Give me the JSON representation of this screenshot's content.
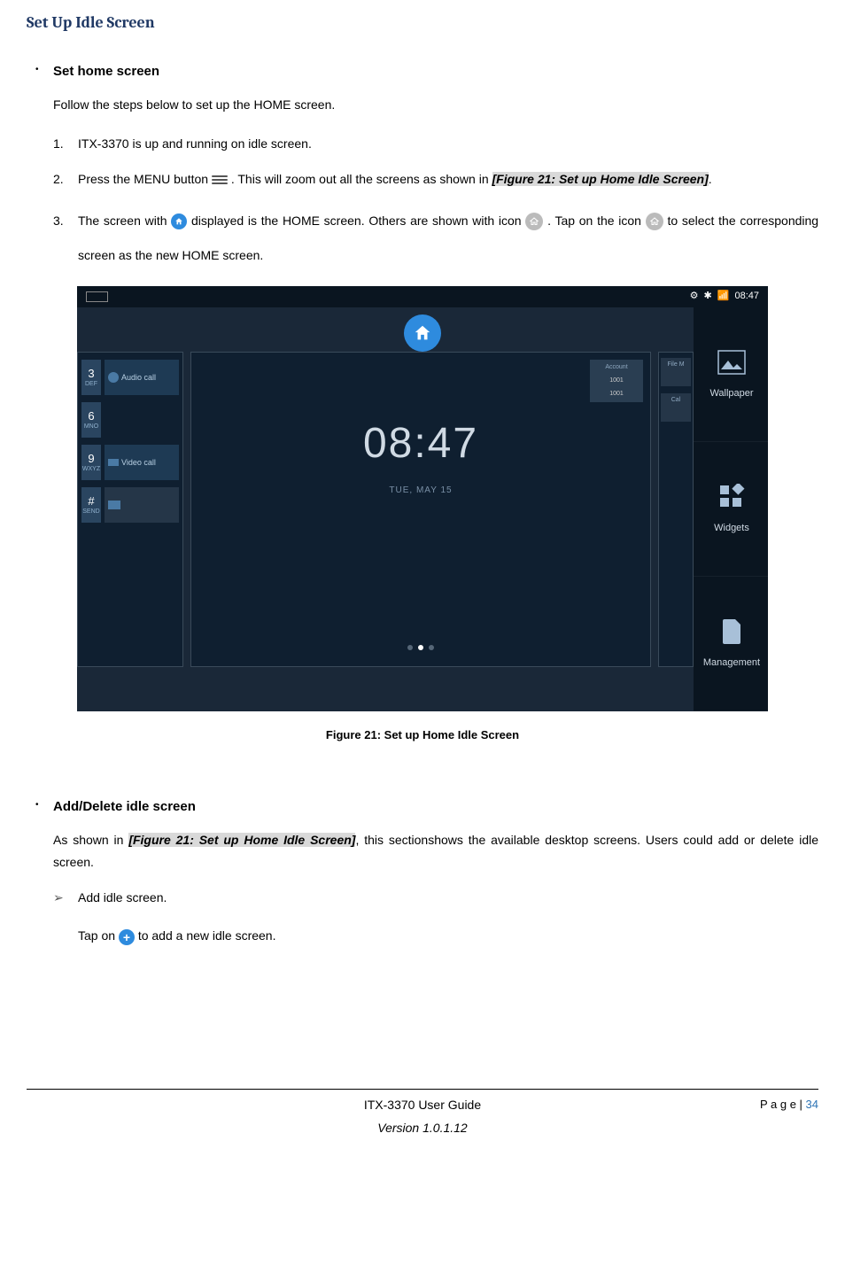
{
  "section_title": "Set Up Idle Screen",
  "set_home": {
    "heading": "Set home screen",
    "intro": "Follow the steps below to set up the HOME screen.",
    "step1": "ITX-3370 is up and running on idle screen.",
    "step2a": "Press the MENU button ",
    "step2b": ". This will zoom out all the screens as shown in ",
    "step2ref": "[Figure 21: Set up Home Idle Screen]",
    "step2c": ".",
    "step3a": "The screen with",
    "step3b": "displayed is the HOME screen. Others are shown with icon",
    "step3c": " . Tap on the icon ",
    "step3d": " to select the corresponding screen as the new HOME screen."
  },
  "screenshot": {
    "time": "08:47",
    "clock_time": "08:47",
    "clock_date": "TUE, MAY 15",
    "account_hdr": "Account",
    "account_num1": "1001",
    "account_num2": "1001",
    "filem": "File M",
    "cal": "Cal",
    "keys": {
      "k3": "3",
      "k3s": "DEF",
      "k6": "6",
      "k6s": "MNO",
      "k9": "9",
      "k9s": "WXYZ",
      "kh": "#",
      "khs": "SEND"
    },
    "audio_call": "Audio call",
    "video_call": "Video call",
    "side": {
      "wallpaper": "Wallpaper",
      "widgets": "Widgets",
      "management": "Management"
    }
  },
  "figure_caption": "Figure 21: Set up Home Idle Screen",
  "add_delete": {
    "heading": "Add/Delete idle screen",
    "body_a": "As shown in ",
    "body_ref": "[Figure 21: Set up Home Idle Screen]",
    "body_b": ", this sectionshows the available desktop screens. Users could add or delete idle screen.",
    "sub1": "Add idle screen.",
    "sub1_body_a": "Tap on",
    "sub1_body_b": "to add a new idle screen."
  },
  "footer": {
    "page_label": "P a g e | ",
    "page_num": "34",
    "guide": "ITX-3370 User Guide",
    "version": "Version 1.0.1.12"
  }
}
